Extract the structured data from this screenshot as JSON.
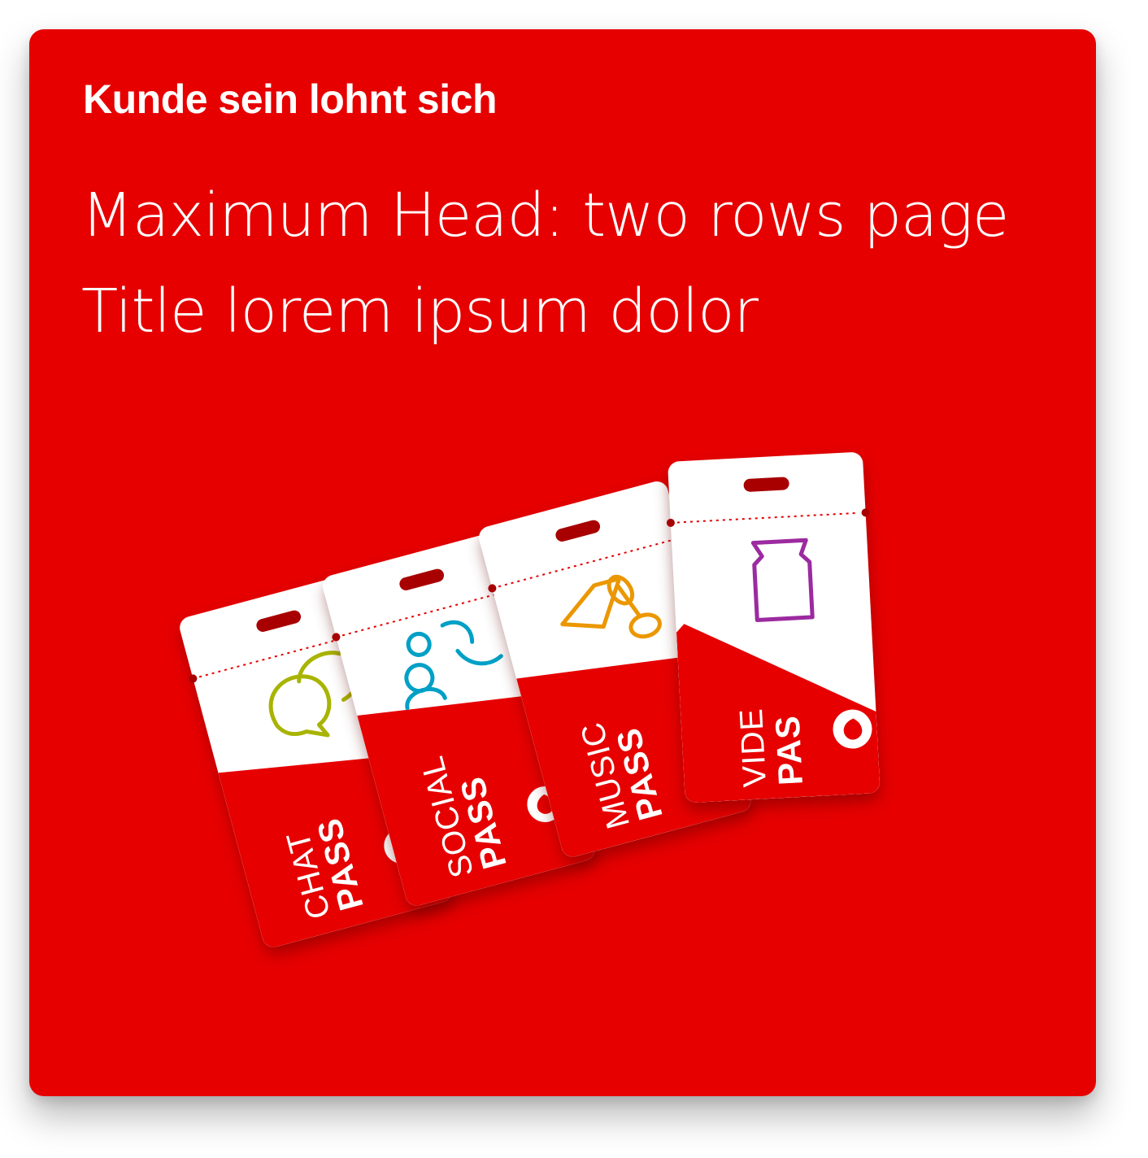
{
  "banner": {
    "eyebrow": "Kunde sein lohnt sich",
    "headline_line1": "Maximum Head: two rows page",
    "headline_line2": "Title lorem ipsum dolor",
    "background_color": "#e60000",
    "text_color": "#ffffff"
  },
  "passes": [
    {
      "type": "CHAT",
      "word": "PASS",
      "icon": "chat-bubbles-icon",
      "icon_color": "#a8b400"
    },
    {
      "type": "SOCIAL",
      "word": "PASS",
      "icon": "people-icon",
      "icon_color": "#00a0c6"
    },
    {
      "type": "MUSIC",
      "word": "PASS",
      "icon": "music-note-icon",
      "icon_color": "#eb9700"
    },
    {
      "type": "VIDE",
      "word": "PAS",
      "icon": "video-icon",
      "icon_color": "#9c2aa0"
    }
  ]
}
